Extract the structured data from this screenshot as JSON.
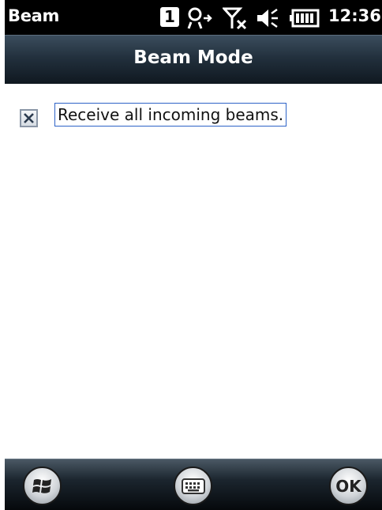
{
  "status_bar": {
    "app_name": "Beam",
    "badge": "1",
    "clock": "12:36",
    "icons": [
      "notification-badge",
      "connectivity-icon",
      "no-signal-icon",
      "volume-icon",
      "battery-icon"
    ]
  },
  "title_bar": {
    "title": "Beam Mode"
  },
  "content": {
    "checkbox": {
      "label": "Receive all incoming beams.",
      "checked": true
    }
  },
  "bottom_bar": {
    "start_icon": "windows-start-icon",
    "keyboard_icon": "keyboard-icon",
    "ok_label": "OK"
  }
}
